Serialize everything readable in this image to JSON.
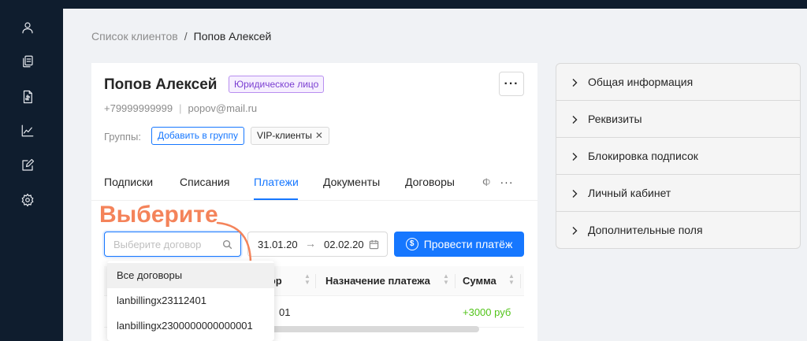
{
  "breadcrumb": {
    "parent": "Список клиентов",
    "separator": "/",
    "current": "Попов Алексей"
  },
  "client": {
    "name": "Попов Алексей",
    "type_badge": "Юридическое лицо",
    "phone": "+79999999999",
    "contact_separator": "|",
    "email": "popov@mail.ru",
    "more_label": "···"
  },
  "groups": {
    "label": "Группы:",
    "add_button": "Добавить в группу",
    "tags": [
      {
        "label": "VIP-клиенты",
        "remove": "✕"
      }
    ]
  },
  "tabs": [
    {
      "label": "Подписки"
    },
    {
      "label": "Списания"
    },
    {
      "label": "Платежи"
    },
    {
      "label": "Документы"
    },
    {
      "label": "Договоры"
    },
    {
      "label": "Ф"
    }
  ],
  "tabs_more": "···",
  "annotation": "Выберите",
  "filters": {
    "contract_placeholder": "Выберите договор",
    "date_from": "31.01.20",
    "date_arrow": "→",
    "date_to": "02.02.20",
    "pay_button": "Провести платёж",
    "pay_icon_glyph": "$"
  },
  "table": {
    "columns": [
      {
        "label": "овор",
        "sortable": true
      },
      {
        "label": "Назначение платежа",
        "sortable": true
      },
      {
        "label": "Сумма",
        "sortable": true
      }
    ],
    "rows": [
      {
        "contract": "01",
        "amount": "+3000 руб"
      }
    ]
  },
  "dropdown": {
    "options": [
      {
        "label": "Все договоры",
        "selected": true
      },
      {
        "label": "lanbillingx23112401"
      },
      {
        "label": "lanbillingx2300000000000001"
      }
    ]
  },
  "side_panels": [
    {
      "label": "Общая информация"
    },
    {
      "label": "Реквизиты"
    },
    {
      "label": "Блокировка подписок"
    },
    {
      "label": "Личный кабинет"
    },
    {
      "label": "Дополнительные поля"
    }
  ],
  "colors": {
    "primary": "#1677ff",
    "sidebar": "#0f1d2e",
    "annotation": "#f4835a",
    "success": "#52c41a",
    "badge_purple": "#7b3fd1"
  },
  "sidebar_icons": [
    "user-icon",
    "copy-documents-icon",
    "invoice-icon",
    "chart-line-icon",
    "edit-square-icon",
    "settings-gear-icon"
  ]
}
